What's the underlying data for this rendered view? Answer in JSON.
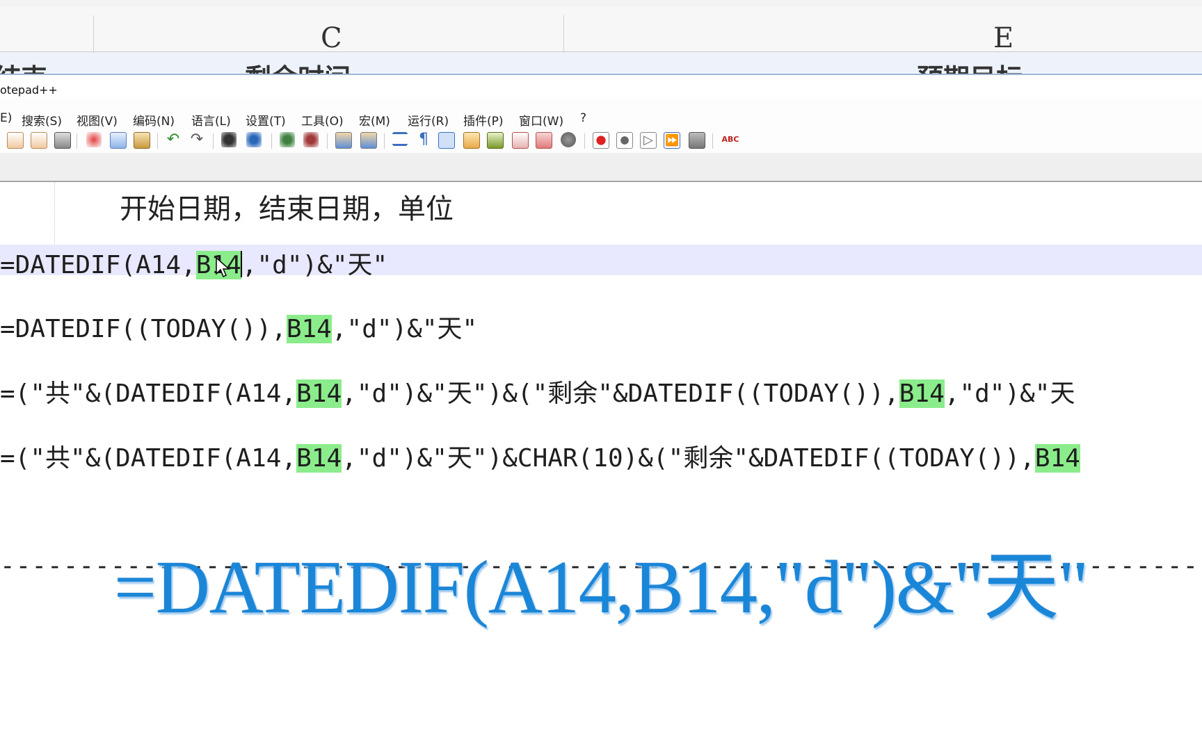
{
  "excel": {
    "columns": [
      "C",
      "E"
    ],
    "peek_left": "结束",
    "peek_mid": "剩余时间",
    "peek_right": "预期目标"
  },
  "window": {
    "title": "otepad++"
  },
  "menu": [
    "E)",
    "搜索(S)",
    "视图(V)",
    "编码(N)",
    "语言(L)",
    "设置(T)",
    "工具(O)",
    "宏(M)",
    "运行(R)",
    "插件(P)",
    "窗口(W)",
    "?"
  ],
  "toolbar": {
    "icons": [
      "new-file-icon",
      "open-file-icon",
      "save-icon",
      "print-icon",
      "cut-icon",
      "copy-icon",
      "paste-icon",
      "undo-icon",
      "redo-icon",
      "find-icon",
      "replace-icon",
      "zoom-in-icon",
      "zoom-out-icon",
      "sync-v-icon",
      "sync-h-icon",
      "word-wrap-icon",
      "show-all-chars-icon",
      "indent-guide-icon",
      "doc-map-icon",
      "function-list-icon",
      "folder-workspace-icon",
      "monitor-icon",
      "record-macro-icon",
      "stop-record-icon",
      "play-macro-icon",
      "run-macro-multiple-icon",
      "save-macro-icon",
      "spell-check-icon"
    ],
    "spell_label": "ABC"
  },
  "editor": {
    "comment": "开始日期，结束日期，单位",
    "line1": {
      "a": "=DATEDIF(A14,",
      "b": "B14",
      "c": ",\"d\")&\"天\""
    },
    "line2": {
      "a": "=DATEDIF((TODAY()),",
      "b": "B14",
      "c": ",\"d\")&\"天\""
    },
    "line3": {
      "a": "=(\"共\"&(DATEDIF(A14,",
      "b": "B14",
      "c": ",\"d\")&\"天\")&(\"剩余\"&DATEDIF((TODAY()),",
      "d": "B14",
      "e": ",\"d\")&\"天"
    },
    "line4": {
      "a": "=(\"共\"&(DATEDIF(A14,",
      "b": "B14",
      "c": ",\"d\")&\"天\")&CHAR(10)&(\"剩余\"&DATEDIF((TODAY()),",
      "d": "B14"
    },
    "dashes": "--------------------------------------------------------------------------------"
  },
  "overlay": {
    "formula": "=DATEDIF(A14,B14,\"d\")&\"天\""
  },
  "colors": {
    "highlight": "#8bec8b",
    "current_line": "#e8e8ff",
    "overlay_text": "#1a86d8"
  }
}
